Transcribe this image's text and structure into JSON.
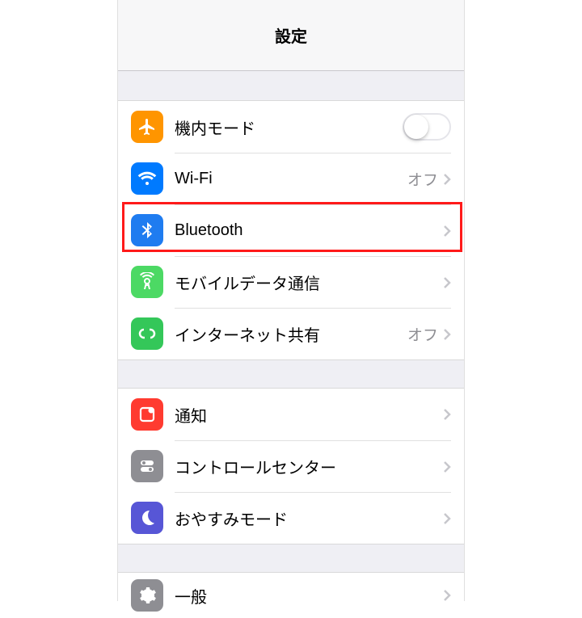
{
  "header": {
    "title": "設定"
  },
  "groups": [
    {
      "rows": [
        {
          "id": "airplane",
          "icon": "airplane-icon",
          "label": "機内モード",
          "type": "toggle",
          "enabled": false
        },
        {
          "id": "wifi",
          "icon": "wifi-icon",
          "label": "Wi-Fi",
          "type": "link",
          "detail": "オフ"
        },
        {
          "id": "bluetooth",
          "icon": "bluetooth-icon",
          "label": "Bluetooth",
          "type": "link",
          "detail": "",
          "highlighted": true
        },
        {
          "id": "cellular",
          "icon": "cellular-icon",
          "label": "モバイルデータ通信",
          "type": "link",
          "detail": ""
        },
        {
          "id": "hotspot",
          "icon": "hotspot-icon",
          "label": "インターネット共有",
          "type": "link",
          "detail": "オフ"
        }
      ]
    },
    {
      "rows": [
        {
          "id": "notifications",
          "icon": "notifications-icon",
          "label": "通知",
          "type": "link",
          "detail": ""
        },
        {
          "id": "controlcenter",
          "icon": "controlcenter-icon",
          "label": "コントロールセンター",
          "type": "link",
          "detail": ""
        },
        {
          "id": "dnd",
          "icon": "dnd-icon",
          "label": "おやすみモード",
          "type": "link",
          "detail": ""
        }
      ]
    },
    {
      "rows": [
        {
          "id": "general",
          "icon": "general-icon",
          "label": "一般",
          "type": "link",
          "detail": ""
        }
      ]
    }
  ]
}
